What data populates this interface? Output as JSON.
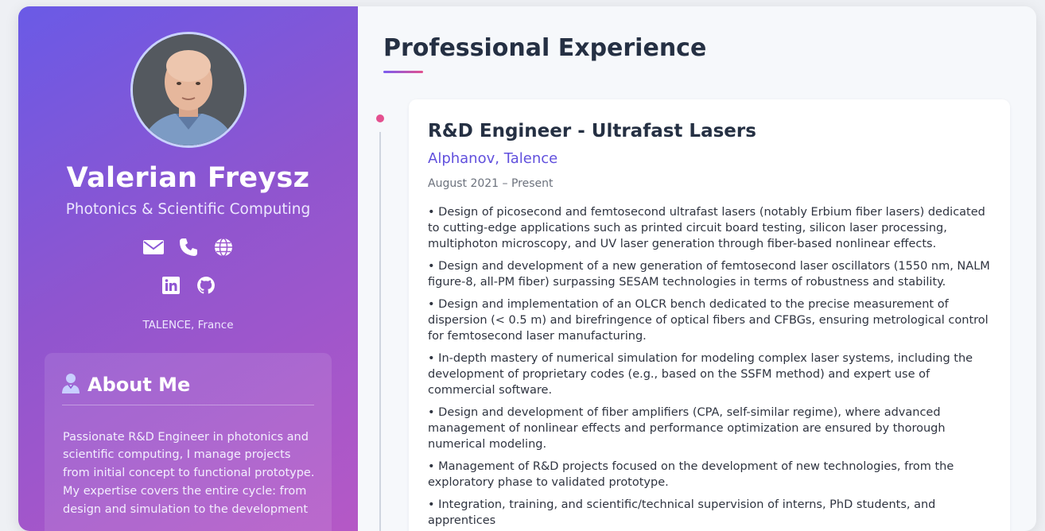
{
  "profile": {
    "name": "Valerian Freysz",
    "subtitle": "Photonics & Scientific Computing",
    "location": "TALENCE, France",
    "contact_icons": [
      "envelope-icon",
      "phone-icon",
      "globe-icon"
    ],
    "social_icons": [
      "linkedin-icon",
      "github-icon"
    ]
  },
  "about": {
    "title": "About Me",
    "icon": "user-icon",
    "text": "Passionate R&D Engineer in photonics and scientific computing, I manage projects from initial concept to functional prototype. My expertise covers the entire cycle: from design and simulation to the development"
  },
  "main": {
    "section_title": "Professional Experience",
    "jobs": [
      {
        "title": "R&D Engineer - Ultrafast Lasers",
        "company": "Alphanov, Talence",
        "dates": "August 2021 – Present",
        "duties": [
          "• Design of picosecond and femtosecond ultrafast lasers (notably Erbium fiber lasers) dedicated to cutting-edge applications such as printed circuit board testing, silicon laser processing, multiphoton microscopy, and UV laser generation through fiber-based nonlinear effects.",
          "• Design and development of a new generation of femtosecond laser oscillators (1550 nm, NALM figure-8, all-PM fiber) surpassing SESAM technologies in terms of robustness and stability.",
          "• Design and implementation of an OLCR bench dedicated to the precise measurement of dispersion (< 0.5 m) and birefringence of optical fibers and CFBGs, ensuring metrological control for femtosecond laser manufacturing.",
          "• In-depth mastery of numerical simulation for modeling complex laser systems, including the development of proprietary codes (e.g., based on the SSFM method) and expert use of commercial software.",
          "• Design and development of fiber amplifiers (CPA, self-similar regime), where advanced management of nonlinear effects and performance optimization are ensured by thorough numerical modeling.",
          "• Management of R&D projects focused on the development of new technologies, from the exploratory phase to validated prototype.",
          "• Integration, training, and scientific/technical supervision of interns, PhD students, and apprentices"
        ]
      }
    ]
  },
  "colors": {
    "sidebar_gradient": [
      "#6a5ae6",
      "#b558c6"
    ],
    "accent": "#6150dd",
    "timeline_dot": "#e4508f",
    "title": "#253043"
  }
}
